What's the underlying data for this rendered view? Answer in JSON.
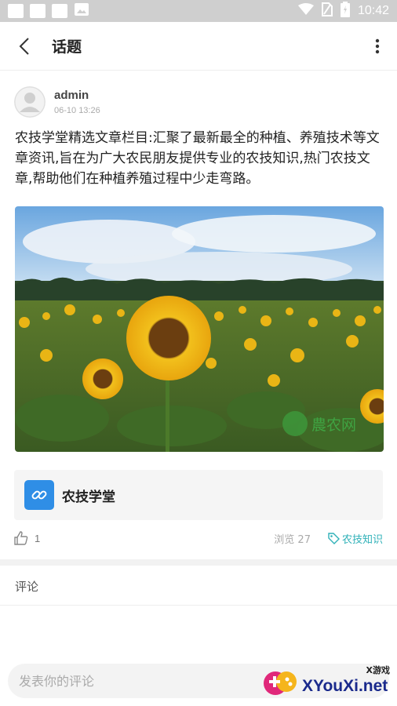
{
  "status_bar": {
    "time": "10:42"
  },
  "header": {
    "title": "话题"
  },
  "post": {
    "author": "admin",
    "date": "06-10 13:26",
    "content": "农技学堂精选文章栏目:汇聚了最新最全的种植、养殖技术等文章资讯,旨在为广大农民朋友提供专业的农技知识,热门农技文章,帮助他们在种植养殖过程中少走弯路。",
    "image_watermark": "農农网",
    "link_card_label": "农技学堂",
    "likes": "1",
    "views": "浏览 27",
    "tag": "农技知识"
  },
  "comments": {
    "heading": "评论",
    "placeholder": "发表你的评论"
  },
  "watermark": {
    "brand": "XYouXi.net",
    "small": "X游戏"
  }
}
